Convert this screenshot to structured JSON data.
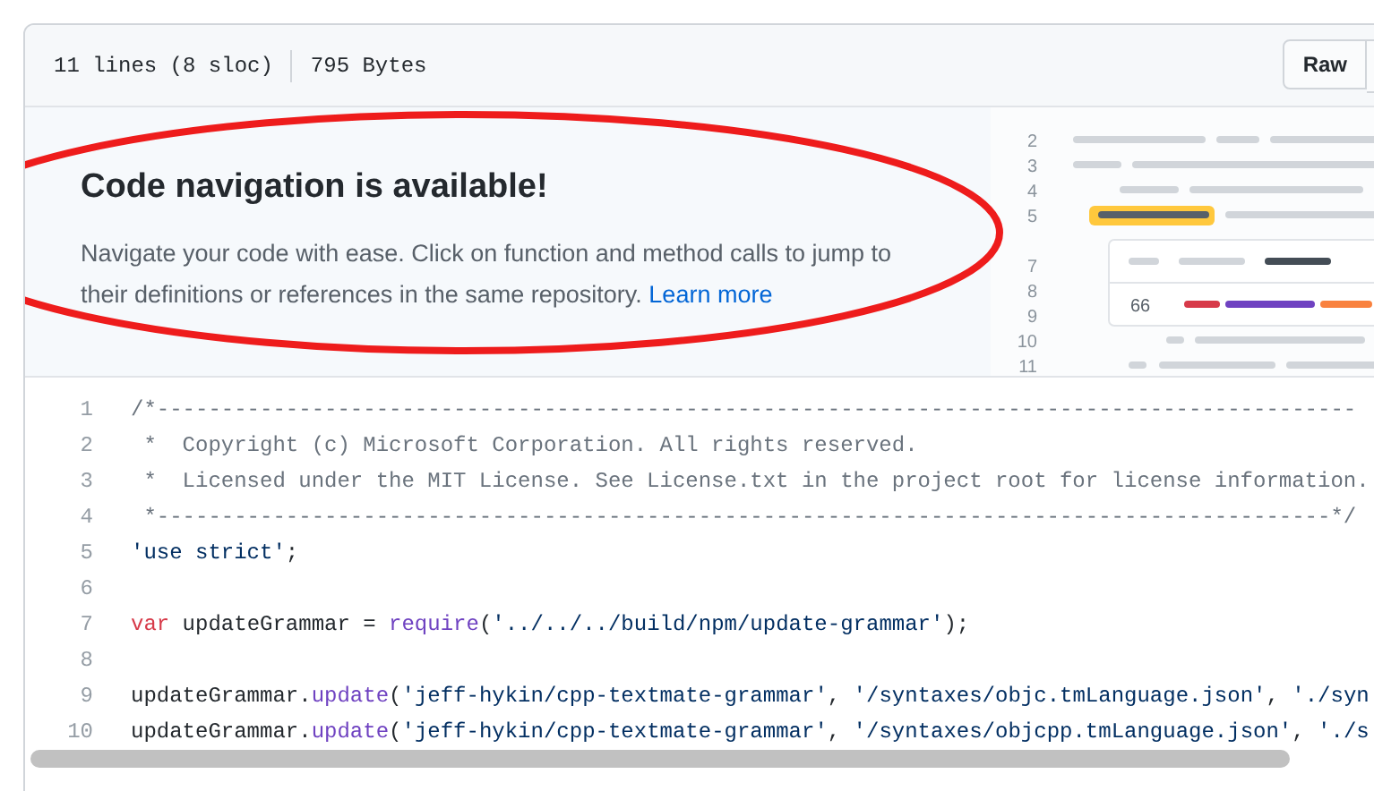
{
  "file_info": {
    "lines": "11 lines (8 sloc)",
    "size": "795 Bytes"
  },
  "actions": [
    "Raw"
  ],
  "banner": {
    "title": "Code navigation is available!",
    "text": "Navigate your code with ease. Click on function and method calls to jump to their definitions or references in the same repository.",
    "link": "Learn more"
  },
  "illustration": {
    "line_numbers": [
      "2",
      "3",
      "4",
      "5",
      "7",
      "8",
      "9",
      "10",
      "11"
    ],
    "reference_count": "66"
  },
  "code": [
    {
      "number": "1",
      "tokens": [
        {
          "kind": "comment",
          "text": "/*---------------------------------------------------------------------------------------------"
        }
      ]
    },
    {
      "number": "2",
      "tokens": [
        {
          "kind": "comment",
          "text": " *  Copyright (c) Microsoft Corporation. All rights reserved."
        }
      ]
    },
    {
      "number": "3",
      "tokens": [
        {
          "kind": "comment",
          "text": " *  Licensed under the MIT License. See License.txt in the project root for license information."
        }
      ]
    },
    {
      "number": "4",
      "tokens": [
        {
          "kind": "comment",
          "text": " *-------------------------------------------------------------------------------------------*/"
        }
      ]
    },
    {
      "number": "5",
      "tokens": [
        {
          "kind": "string",
          "text": "'use strict'"
        },
        {
          "kind": "plain",
          "text": ";"
        }
      ]
    },
    {
      "number": "6"
    },
    {
      "number": "7",
      "tokens": [
        {
          "kind": "keyword",
          "text": "var"
        },
        {
          "kind": "plain",
          "text": " updateGrammar = "
        },
        {
          "kind": "function",
          "text": "require"
        },
        {
          "kind": "plain",
          "text": "("
        },
        {
          "kind": "string",
          "text": "'../../../build/npm/update-grammar'"
        },
        {
          "kind": "plain",
          "text": ");"
        }
      ]
    },
    {
      "number": "8"
    },
    {
      "number": "9",
      "tokens": [
        {
          "kind": "plain",
          "text": "updateGrammar."
        },
        {
          "kind": "function",
          "text": "update"
        },
        {
          "kind": "plain",
          "text": "("
        },
        {
          "kind": "string",
          "text": "'jeff-hykin/cpp-textmate-grammar'"
        },
        {
          "kind": "plain",
          "text": ", "
        },
        {
          "kind": "string",
          "text": "'/syntaxes/objc.tmLanguage.json'"
        },
        {
          "kind": "plain",
          "text": ", "
        },
        {
          "kind": "string",
          "text": "'./syn"
        }
      ]
    },
    {
      "number": "10",
      "tokens": [
        {
          "kind": "plain",
          "text": "updateGrammar."
        },
        {
          "kind": "function",
          "text": "update"
        },
        {
          "kind": "plain",
          "text": "("
        },
        {
          "kind": "string",
          "text": "'jeff-hykin/cpp-textmate-grammar'"
        },
        {
          "kind": "plain",
          "text": ", "
        },
        {
          "kind": "string",
          "text": "'/syntaxes/objcpp.tmLanguage.json'"
        },
        {
          "kind": "plain",
          "text": ", "
        },
        {
          "kind": "string",
          "text": "'./s"
        }
      ]
    }
  ]
}
